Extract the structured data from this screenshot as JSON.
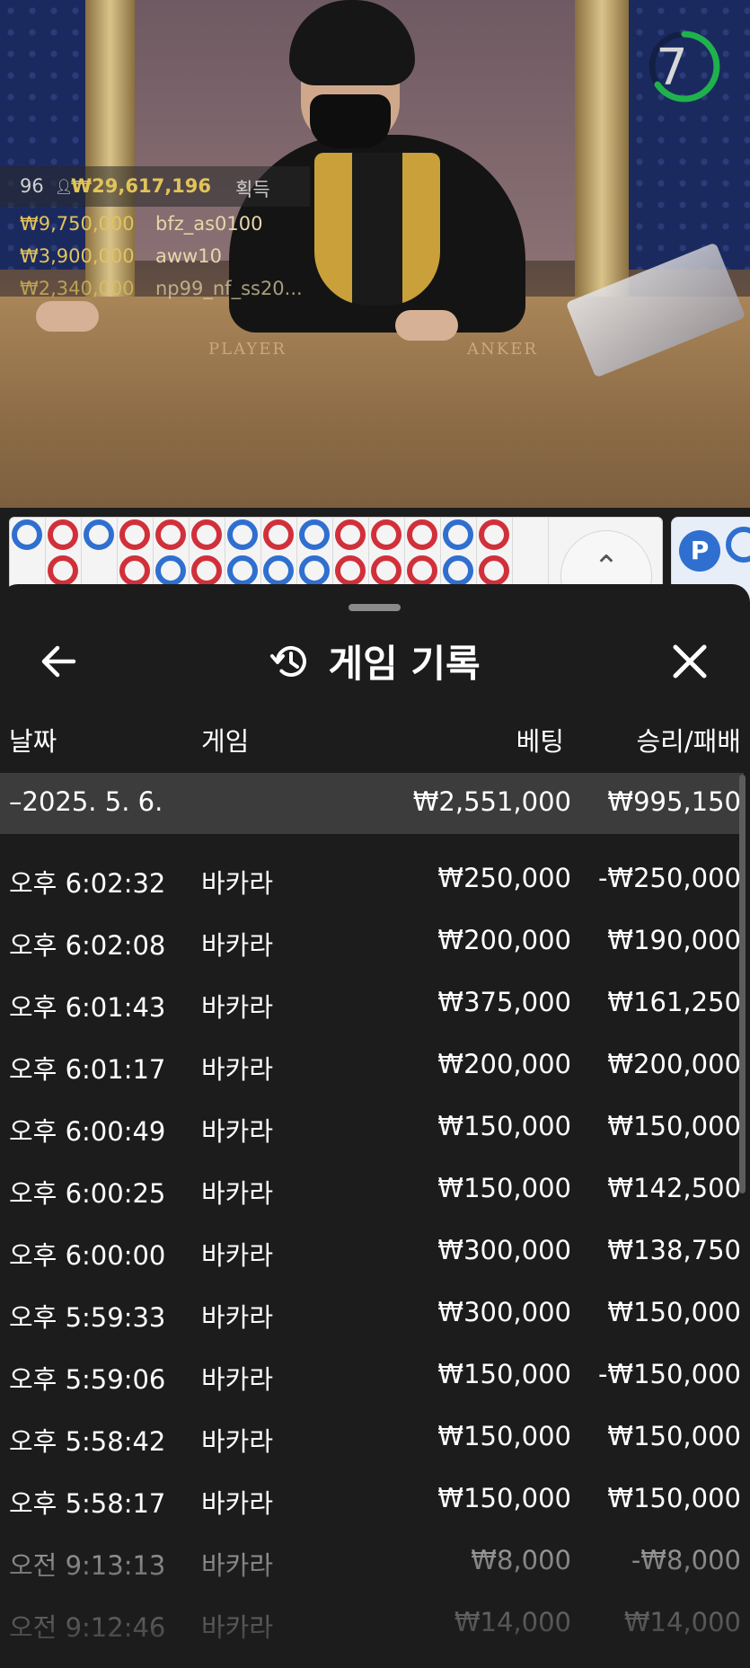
{
  "timer": {
    "value": "7",
    "color": "#1fb24c"
  },
  "leaderboard": {
    "count": "96",
    "total": "₩29,617,196",
    "total_suffix": "획득",
    "winners": [
      {
        "amount": "₩9,750,000",
        "name": "bfz_as0100"
      },
      {
        "amount": "₩3,900,000",
        "name": "aww10"
      },
      {
        "amount": "₩2,340,000",
        "name": "np99_nf_ss20..."
      }
    ]
  },
  "table_labels": {
    "player": "PLAYER",
    "banker": "ANKER"
  },
  "side_panel": {
    "p_label": "P"
  },
  "roadmap": {
    "expand_icon": "chevron-double-up-icon",
    "row1": [
      "b",
      "r",
      "b",
      "rb",
      "r",
      "r",
      "b",
      "r",
      "b",
      "r",
      "rb",
      "r",
      "b",
      "r"
    ],
    "row2": [
      "",
      "r",
      "",
      "r",
      "b",
      "r",
      "b",
      "b",
      "b",
      "rb",
      "r",
      "r",
      "b",
      "r"
    ]
  },
  "history": {
    "title": "게임 기록",
    "title_icon": "history-icon",
    "back_icon": "arrow-left-icon",
    "close_icon": "close-icon",
    "columns": {
      "date": "날짜",
      "game": "게임",
      "bet": "베팅",
      "result": "승리/패배"
    },
    "day": {
      "label": "–2025. 5. 6.",
      "bet": "₩2,551,000",
      "result": "₩995,150"
    },
    "rows": [
      {
        "time": "오후 6:02:32",
        "game": "바카라",
        "bet": "₩250,000",
        "result": "-₩250,000"
      },
      {
        "time": "오후 6:02:08",
        "game": "바카라",
        "bet": "₩200,000",
        "result": "₩190,000"
      },
      {
        "time": "오후 6:01:43",
        "game": "바카라",
        "bet": "₩375,000",
        "result": "₩161,250"
      },
      {
        "time": "오후 6:01:17",
        "game": "바카라",
        "bet": "₩200,000",
        "result": "₩200,000"
      },
      {
        "time": "오후 6:00:49",
        "game": "바카라",
        "bet": "₩150,000",
        "result": "₩150,000"
      },
      {
        "time": "오후 6:00:25",
        "game": "바카라",
        "bet": "₩150,000",
        "result": "₩142,500"
      },
      {
        "time": "오후 6:00:00",
        "game": "바카라",
        "bet": "₩300,000",
        "result": "₩138,750"
      },
      {
        "time": "오후 5:59:33",
        "game": "바카라",
        "bet": "₩300,000",
        "result": "₩150,000"
      },
      {
        "time": "오후 5:59:06",
        "game": "바카라",
        "bet": "₩150,000",
        "result": "-₩150,000"
      },
      {
        "time": "오후 5:58:42",
        "game": "바카라",
        "bet": "₩150,000",
        "result": "₩150,000"
      },
      {
        "time": "오후 5:58:17",
        "game": "바카라",
        "bet": "₩150,000",
        "result": "₩150,000"
      },
      {
        "time": "오전 9:13:13",
        "game": "바카라",
        "bet": "₩8,000",
        "result": "-₩8,000"
      },
      {
        "time": "오전 9:12:46",
        "game": "바카라",
        "bet": "₩14,000",
        "result": "₩14,000"
      }
    ]
  }
}
